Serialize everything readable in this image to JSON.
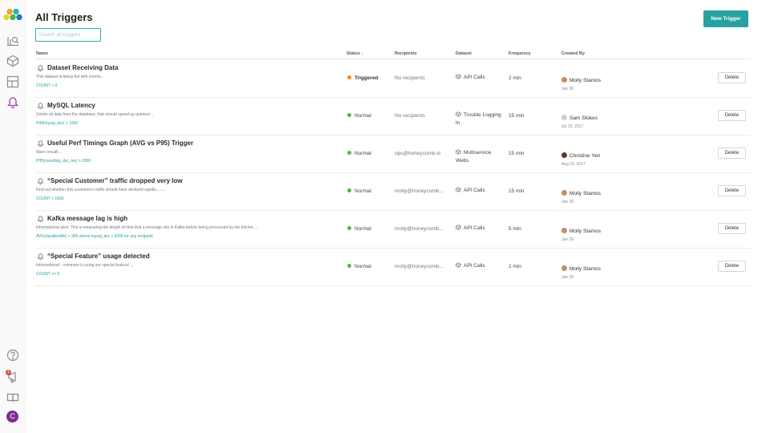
{
  "page": {
    "title": "All Triggers"
  },
  "search": {
    "placeholder": "Search all triggers"
  },
  "toolbar": {
    "new_trigger_label": "New Trigger"
  },
  "colors": {
    "accent": "#27a2a0",
    "triggered": "#f08a24",
    "normal": "#4cb944",
    "active_nav": "#a23ab8"
  },
  "sidebar": {
    "items": [
      {
        "icon": "query-builder-icon"
      },
      {
        "icon": "dataset-cube-icon"
      },
      {
        "icon": "board-layout-icon"
      },
      {
        "icon": "bell-icon",
        "active": true
      }
    ],
    "bottom": [
      {
        "icon": "help-icon"
      },
      {
        "icon": "announcement-icon",
        "badge": "1"
      },
      {
        "icon": "docs-book-icon"
      }
    ],
    "user_initial": "C"
  },
  "table": {
    "headers": {
      "name": "Name",
      "status": "Status ↓",
      "recipients": "Recipients",
      "dataset": "Dataset",
      "frequency": "Frequency",
      "created_by": "Created By"
    },
    "delete_label": "Delete",
    "rows": [
      {
        "name": "Dataset Receiving Data",
        "description": "This dataset is being fed with events...",
        "query": "COUNT > 0",
        "status": "Triggered",
        "recipients": "No recipients",
        "dataset": "API Calls",
        "frequency": "2 min",
        "creator": "Molly Stamos",
        "date": "Jan 30"
      },
      {
        "name": "MySQL Latency",
        "description": "Delete all data from the database, that should speed up queries!...",
        "query": "P99(mysql_dur) > 1000",
        "status": "Normal",
        "recipients": "No recipients",
        "dataset": "Trouble Logging In",
        "frequency": "15 min",
        "creator": "Sam Stokes",
        "date": "Jul 13, 2017"
      },
      {
        "name": "Useful Perf Timings Graph (AVG vs P95) Trigger",
        "description": "Warn oncall!...",
        "query": "P95(roundtrip_dur_ms) > 2000",
        "status": "Normal",
        "recipients": "ops@honeycomb.io",
        "dataset": "Multiservice Webs",
        "frequency": "15 min",
        "creator": "Christine Yen",
        "date": "Aug 22, 2017"
      },
      {
        "name": "“Special Customer” traffic dropped very low",
        "description": "Find out whether this customer's traffic should have declined rapidly.........",
        "query": "COUNT < 1000",
        "status": "Normal",
        "recipients": "molly@honeycomb...",
        "dataset": "API Calls",
        "frequency": "15 min",
        "creator": "Molly Stamos",
        "date": "Jan 29"
      },
      {
        "name": "Kafka message lag is high",
        "description": "Informational alert. This is measuring the length of time that a message sits in Kafka before being processed by the fetcher....",
        "query": "AVG(durationMs) > 300 where mysql_dur > 2000 for any endpoint",
        "status": "Normal",
        "recipients": "molly@honeycomb...",
        "dataset": "API Calls",
        "frequency": "5 min",
        "creator": "Molly Stamos",
        "date": "Jan 29"
      },
      {
        "name": "“Special Feature” usage detected",
        "description": "Informational - someone is using our special feature! ...",
        "query": "COUNT >= 0",
        "status": "Normal",
        "recipients": "molly@honeycomb...",
        "dataset": "API Calls",
        "frequency": "1 min",
        "creator": "Molly Stamos",
        "date": "Jan 29"
      }
    ]
  }
}
